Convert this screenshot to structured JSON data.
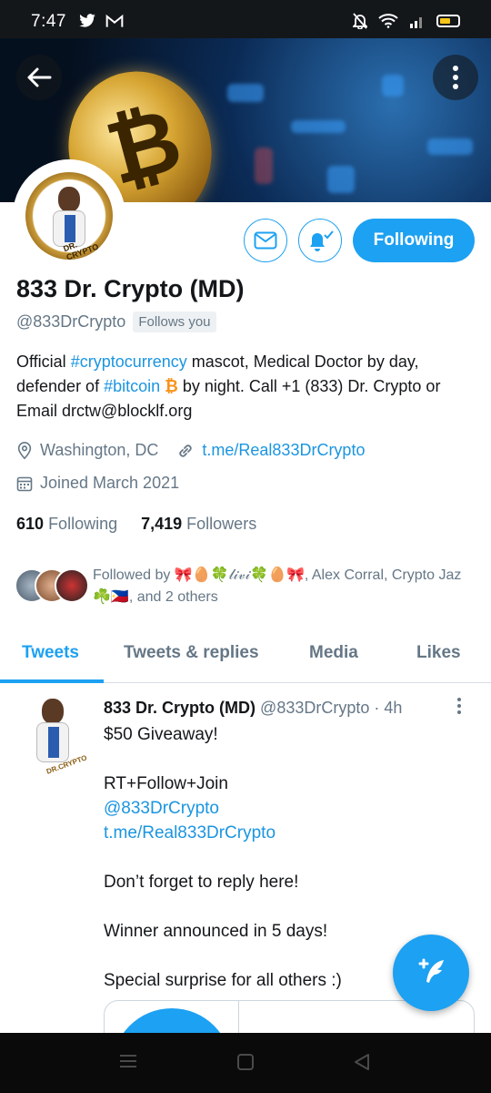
{
  "status_bar": {
    "time": "7:47",
    "left_icons": [
      "twitter-icon",
      "gmail-icon"
    ],
    "right_icons": [
      "mute-icon",
      "wifi-icon",
      "signal-icon",
      "battery-icon"
    ]
  },
  "header": {
    "back_icon": "arrow-left-icon",
    "more_icon": "more-vertical-icon"
  },
  "profile": {
    "display_name": "833 Dr. Crypto (MD)",
    "handle": "@833DrCrypto",
    "follows_you": "Follows you",
    "following_button": "Following",
    "bio_1": "Official ",
    "bio_tag_1": "#cryptocurrency",
    "bio_2": " mascot, Medical Doctor by day, defender of ",
    "bio_tag_2": "#bitcoin",
    "bio_btc": "₿",
    "bio_3": "  by night. Call +1 (833) Dr. Crypto or Email drctw@blocklf.org",
    "location": "Washington, DC",
    "website": "t.me/Real833DrCrypto",
    "joined": "Joined March 2021",
    "following_count": "610",
    "following_label": "Following",
    "followers_count": "7,419",
    "followers_label": "Followers",
    "followed_by": "Followed by 🎀🥚🍀𝓁𝒾𝓋𝒾🍀🥚🎀, Alex Corral, Crypto Jaz ☘️🇵🇭, and 2 others"
  },
  "tabs": [
    {
      "label": "Tweets",
      "active": true
    },
    {
      "label": "Tweets & replies",
      "active": false
    },
    {
      "label": "Media",
      "active": false
    },
    {
      "label": "Likes",
      "active": false
    }
  ],
  "tweet": {
    "name": "833 Dr. Crypto (MD)",
    "handle_time": "@833DrCrypto · 4h",
    "lines": [
      "$50 Giveaway!",
      "",
      "RT+Follow+Join",
      "@833DrCrypto",
      "t.me/Real833DrCrypto",
      "",
      "Don’t forget to reply here!",
      "",
      "Winner announced in 5 days!",
      "",
      "Special surprise for all others :)"
    ]
  },
  "colors": {
    "accent": "#1da1f2",
    "text": "#14171a",
    "secondary": "#657786"
  }
}
